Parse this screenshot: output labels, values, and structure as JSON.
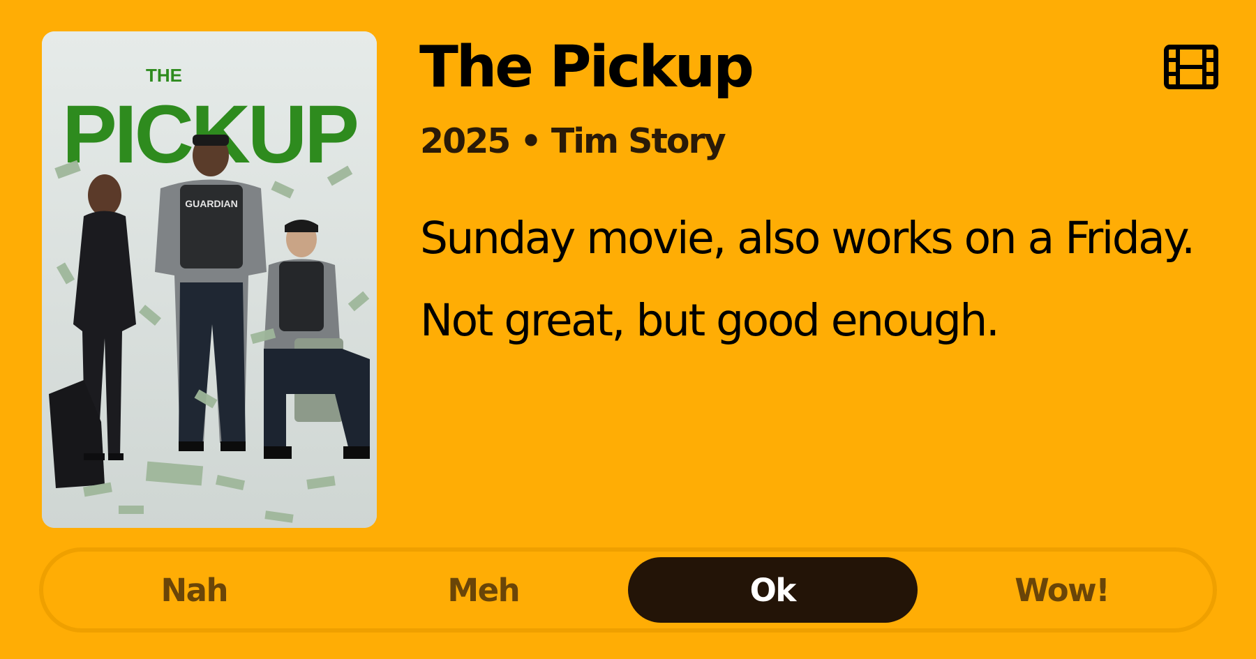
{
  "movie": {
    "title": "The Pickup",
    "year": "2025",
    "separator": "•",
    "director": "Tim Story",
    "subtitle": "2025 • Tim Story",
    "poster": {
      "title_small": "THE",
      "title_big": "PICKUP",
      "vest_text": "GUARDIAN"
    }
  },
  "review": {
    "lines": [
      "Sunday movie, also works on a Friday.",
      "Not great, but good enough."
    ]
  },
  "icons": {
    "media_type": "film-icon"
  },
  "rating": {
    "options": [
      {
        "label": "Nah"
      },
      {
        "label": "Meh"
      },
      {
        "label": "Ok"
      },
      {
        "label": "Wow!"
      }
    ],
    "selected": "Ok"
  },
  "colors": {
    "background": "#FFAD05",
    "selected_bg": "#231407",
    "option_text": "#6A4508",
    "poster_title_green": "#2E8B1E"
  }
}
